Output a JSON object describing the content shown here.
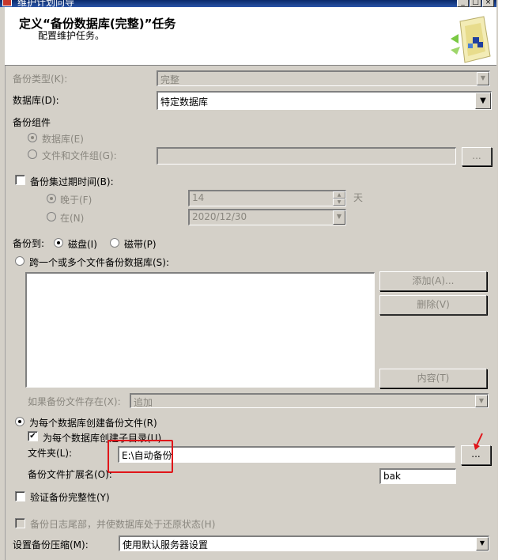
{
  "titlebar": {
    "title": "维护计划向导",
    "min": "_",
    "max": "□",
    "close": "×"
  },
  "header": {
    "title": "定义“备份数据库(完整)”任务",
    "subtitle": "配置维护任务。"
  },
  "backup_type": {
    "label": "备份类型(K):",
    "value": "完整"
  },
  "database": {
    "label": "数据库(D):",
    "value": "特定数据库"
  },
  "component": {
    "group_label": "备份组件",
    "db_label": "数据库(E)",
    "files_label": "文件和文件组(G):",
    "files_value": "",
    "browse": "..."
  },
  "expire": {
    "label": "备份集过期时间(B):",
    "after_label": "晚于(F)",
    "after_value": "14",
    "after_unit": "天",
    "on_label": "在(N)",
    "on_value": "2020/12/30"
  },
  "backup_to": {
    "label": "备份到:",
    "disk": "磁盘(I)",
    "tape": "磁带(P)"
  },
  "span": {
    "label": "跨一个或多个文件备份数据库(S):",
    "add": "添加(A)...",
    "remove": "删除(V)",
    "contents": "内容(T)",
    "exists_label": "如果备份文件存在(X):",
    "exists_value": "追加"
  },
  "per_db": {
    "label": "为每个数据库创建备份文件(R)",
    "subdir_label": "为每个数据库创建子目录(U)",
    "folder_label": "文件夹(L):",
    "folder_value": "E:\\自动备份",
    "folder_browse": "...",
    "ext_label": "备份文件扩展名(O):",
    "ext_value": "bak"
  },
  "verify": {
    "label": "验证备份完整性(Y)"
  },
  "tail_log": {
    "label": "备份日志尾部，并使数据库处于还原状态(H)"
  },
  "compression": {
    "label": "设置备份压缩(M):",
    "value": "使用默认服务器设置"
  },
  "colors": {
    "annotation": "#e0151a",
    "title_bar": "#0a2a6a"
  }
}
